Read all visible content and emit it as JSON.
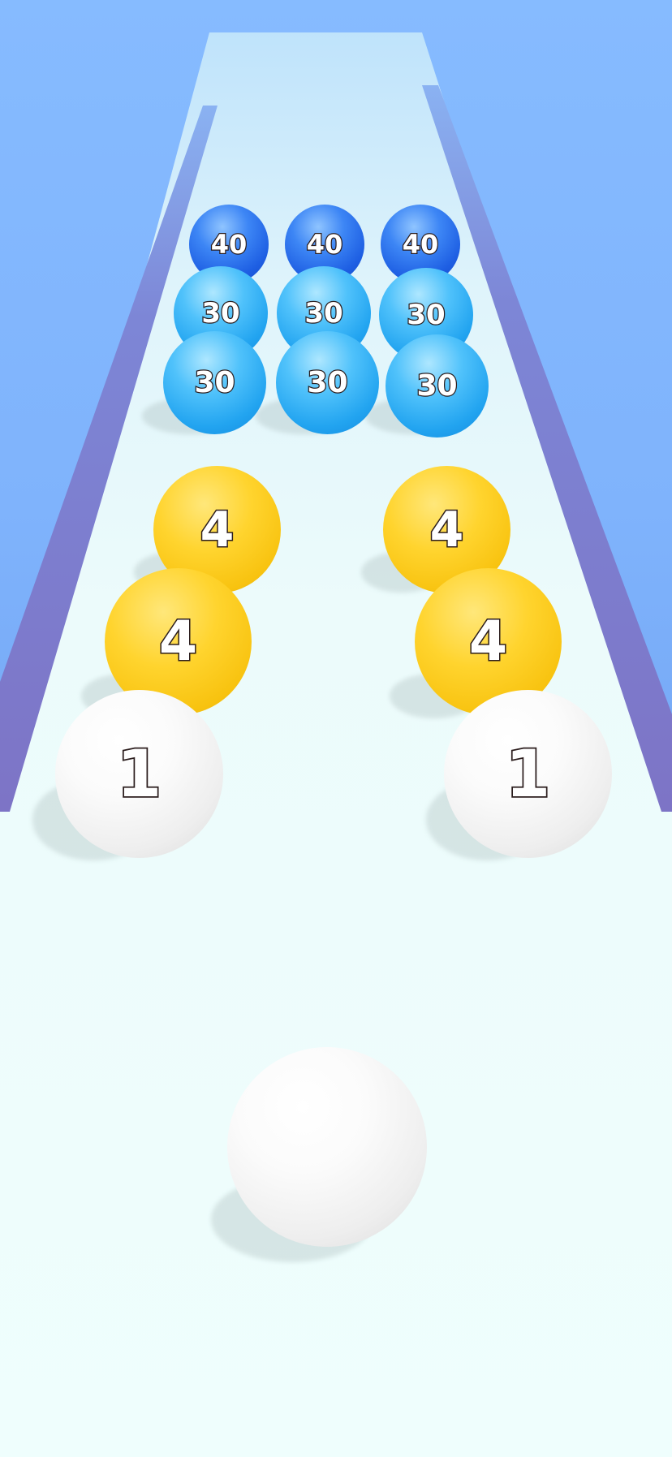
{
  "game": {
    "colors": {
      "sky": "#86bbff",
      "track": "#eefdfc",
      "rail": "#7e76c9",
      "white_ball": "#f5f5f5",
      "yellow_ball": "#ffd42e",
      "light_blue_ball": "#22a4f0",
      "dark_blue_ball": "#1e5fe3"
    },
    "player_ball": {
      "color": "white",
      "label": ""
    },
    "balls": [
      {
        "label": "40",
        "color": "darkblue"
      },
      {
        "label": "40",
        "color": "darkblue"
      },
      {
        "label": "40",
        "color": "darkblue"
      },
      {
        "label": "30",
        "color": "lightblue"
      },
      {
        "label": "30",
        "color": "lightblue"
      },
      {
        "label": "30",
        "color": "lightblue"
      },
      {
        "label": "30",
        "color": "lightblue"
      },
      {
        "label": "30",
        "color": "lightblue"
      },
      {
        "label": "30",
        "color": "lightblue"
      },
      {
        "label": "4",
        "color": "yellow"
      },
      {
        "label": "4",
        "color": "yellow"
      },
      {
        "label": "4",
        "color": "yellow"
      },
      {
        "label": "4",
        "color": "yellow"
      },
      {
        "label": "1",
        "color": "white"
      },
      {
        "label": "1",
        "color": "white"
      }
    ]
  }
}
